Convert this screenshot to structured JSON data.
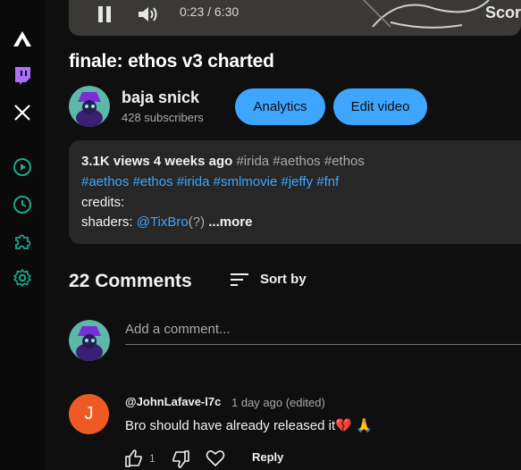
{
  "player": {
    "time": "0:23 / 6:30",
    "overlay_text": "Scor"
  },
  "video": {
    "title": "finale: ethos v3 charted"
  },
  "channel": {
    "name": "baja snick",
    "subscribers": "428 subscribers",
    "analytics_label": "Analytics",
    "edit_label": "Edit video"
  },
  "description": {
    "views": "3.1K views",
    "age": "4 weeks ago",
    "top_tags": "#irida #aethos #ethos",
    "tags": [
      "#aethos",
      "#ethos",
      "#irida",
      "#smlmovie",
      "#jeffy",
      "#fnf"
    ],
    "credits_label": "credits:",
    "shaders_label": "shaders:",
    "shaders_link": "@TixBro",
    "shaders_suffix": "(?)",
    "more_label": "...more"
  },
  "comments": {
    "count_label": "22 Comments",
    "sort_label": "Sort by",
    "add_placeholder": "Add a comment...",
    "items": [
      {
        "avatar_letter": "J",
        "author": "@JohnLafave-l7c",
        "time": "1 day ago (edited)",
        "text": "Bro should have already released it",
        "emojis": "💔 🙏",
        "likes": "1",
        "reply_label": "Reply"
      }
    ]
  },
  "colors": {
    "accent_blue": "#3ea6ff",
    "rail_icon_green": "#1aa88f",
    "twitch_purple": "#a970ff",
    "avatar_orange": "#ef5a24"
  },
  "icons": {
    "rail": [
      "app-logo-icon",
      "twitch-icon",
      "x-icon",
      "play-circle-icon",
      "clock-icon",
      "puzzle-icon",
      "gear-icon"
    ]
  }
}
